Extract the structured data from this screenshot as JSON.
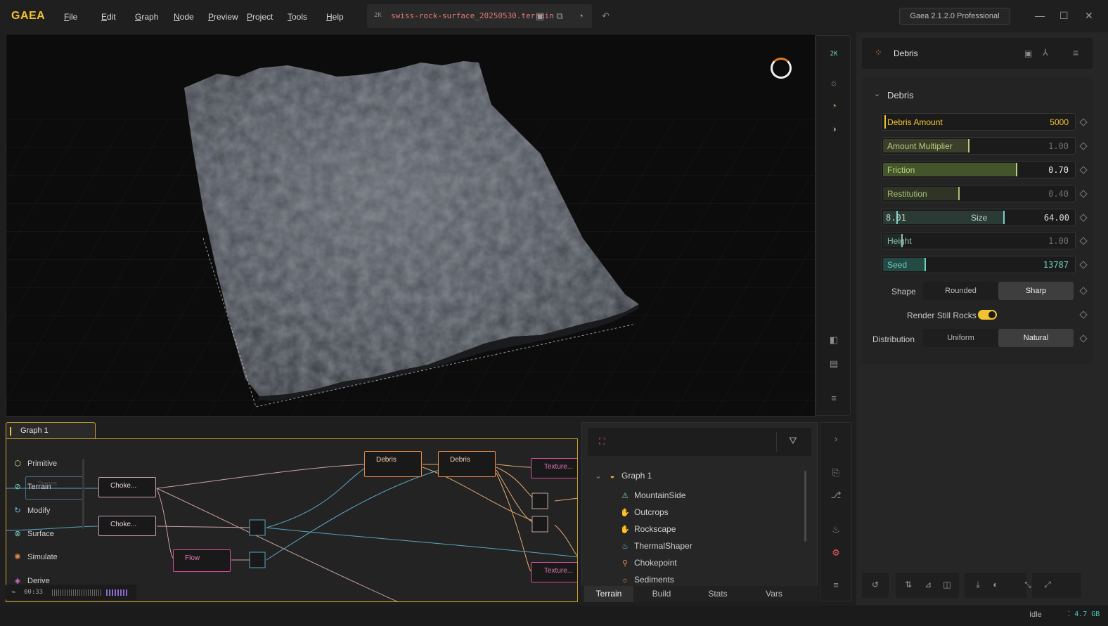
{
  "app": {
    "logo": "GAEA",
    "menu": [
      "File",
      "Edit",
      "Graph",
      "Node",
      "Preview",
      "Project",
      "Tools",
      "Help"
    ],
    "resolution_badge": "2K",
    "file_name": "swiss-rock-surface_20250530.terrain",
    "version": "Gaea 2.1.2.0 Professional",
    "accent_color": "#f2c230"
  },
  "viewport": {
    "resolution_badge": "2K"
  },
  "properties": {
    "node_name": "Debris",
    "section_title": "Debris",
    "fields": [
      {
        "label": "Debris Amount",
        "value": "5000",
        "fraction": 0.0,
        "color": "#f2c230",
        "label_color": "#f2c230",
        "value_color": "#f2c230"
      },
      {
        "label": "Amount Multiplier",
        "value": "1.00",
        "fraction": 0.45,
        "color": "#3a3f2c",
        "label_color": "#b9c97a",
        "value_color": "#6f6f6f"
      },
      {
        "label": "Friction",
        "value": "0.70",
        "fraction": 0.7,
        "color": "#44552b",
        "label_color": "#b9d27a",
        "value_color": "#e6e6e6"
      },
      {
        "label": "Restitution",
        "value": "0.40",
        "fraction": 0.4,
        "color": "#2e3526",
        "label_color": "#a9bf78",
        "value_color": "#6f6f6f"
      },
      {
        "label": "Height",
        "value": "1.00",
        "fraction": 0.1,
        "color": "#1e2a26",
        "label_color": "#8fbfae",
        "value_color": "#6f6f6f"
      },
      {
        "label": "Seed",
        "value": "13787",
        "fraction": 0.22,
        "color": "#234a44",
        "label_color": "#6fd0be",
        "value_color": "#6fd0be"
      }
    ],
    "size_field": {
      "min_value": "8.01",
      "label": "Size",
      "value": "64.00"
    },
    "shape": {
      "label": "Shape",
      "options": [
        "Rounded",
        "Sharp"
      ],
      "selected": "Sharp"
    },
    "render_still_rocks": {
      "label": "Render Still Rocks",
      "on": true
    },
    "distribution": {
      "label": "Distribution",
      "options": [
        "Uniform",
        "Natural"
      ],
      "selected": "Natural"
    }
  },
  "graph": {
    "tab": "Graph 1",
    "palette": [
      {
        "label": "Primitive",
        "icon": "cube-icon",
        "glyph": "⬡",
        "color": "#cfe27a"
      },
      {
        "label": "Terrain",
        "icon": "mountain-icon",
        "glyph": "⊘",
        "color": "#7ad2c8"
      },
      {
        "label": "Modify",
        "icon": "modify-icon",
        "glyph": "↻",
        "color": "#6fb6e0"
      },
      {
        "label": "Surface",
        "icon": "surface-icon",
        "glyph": "⊗",
        "color": "#7ad2c8"
      },
      {
        "label": "Simulate",
        "icon": "simulate-icon",
        "glyph": "✺",
        "color": "#e0894a"
      },
      {
        "label": "Derive",
        "icon": "derive-icon",
        "glyph": "◈",
        "color": "#d06ec8"
      }
    ],
    "ghost_node": "Stages",
    "nodes": [
      {
        "label": "Choke...",
        "color": "#c9a0b8"
      },
      {
        "label": "Choke...",
        "color": "#c9a0b8"
      },
      {
        "label": "Flow",
        "color": "#d2509a"
      },
      {
        "label": "Debris",
        "color": "#e0894a"
      },
      {
        "label": "Debris",
        "color": "#e0894a"
      },
      {
        "label": "Texture...",
        "color": "#d2509a"
      },
      {
        "label": "Texture...",
        "color": "#d2509a"
      }
    ],
    "timer": "00:33"
  },
  "explorer": {
    "tree_root": "Graph 1",
    "items": [
      {
        "label": "MountainSide",
        "icon": "mountain-icon",
        "glyph": "⚠",
        "color": "#7ad2a0"
      },
      {
        "label": "Outcrops",
        "icon": "hand-icon",
        "glyph": "✋",
        "color": "#7ad2c8"
      },
      {
        "label": "Rockscape",
        "icon": "hand-icon",
        "glyph": "✋",
        "color": "#7ad2c8"
      },
      {
        "label": "ThermalShaper",
        "icon": "thermal-icon",
        "glyph": "♨",
        "color": "#6fb6e0"
      },
      {
        "label": "Chokepoint",
        "icon": "chokepoint-icon",
        "glyph": "⚲",
        "color": "#e0894a"
      },
      {
        "label": "Sediments",
        "icon": "sediment-icon",
        "glyph": "☼",
        "color": "#e0894a"
      }
    ],
    "tabs": [
      "Terrain",
      "Build",
      "Stats",
      "Vars"
    ],
    "active_tab": "Terrain"
  },
  "status": {
    "state": "Idle",
    "memory": "4.7 GB"
  }
}
